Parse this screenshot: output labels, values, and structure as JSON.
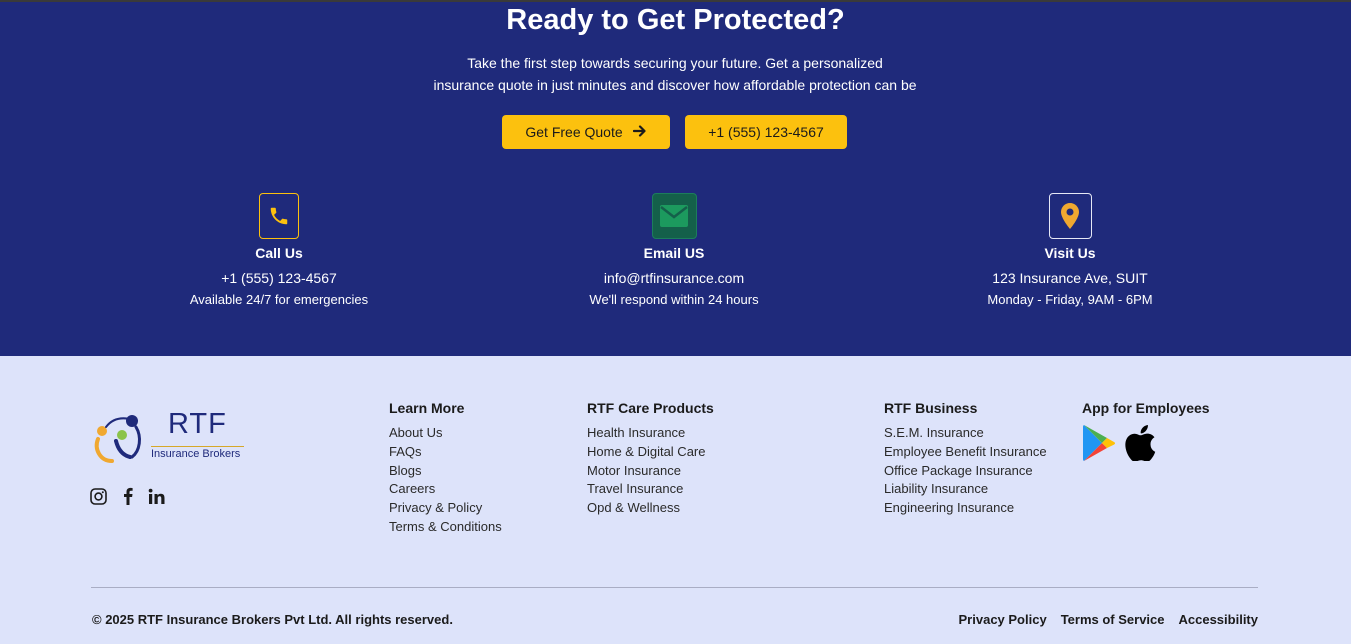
{
  "cta": {
    "title": "Ready to Get Protected?",
    "subtitle_line1": "Take the first step towards securing your future. Get a personalized",
    "subtitle_line2": "insurance quote in just minutes and discover how affordable protection can be",
    "quote_button": "Get Free Quote",
    "phone_button": "+1 (555) 123-4567"
  },
  "contacts": [
    {
      "icon": "phone-icon",
      "title": "Call Us",
      "line1": "+1 (555) 123-4567",
      "line2": "Available 24/7 for emergencies"
    },
    {
      "icon": "envelope-icon",
      "title": "Email US",
      "line1": "info@rtfinsurance.com",
      "line2": "We'll respond within 24 hours"
    },
    {
      "icon": "map-pin-icon",
      "title": "Visit Us",
      "line1": "123 Insurance Ave, SUIT",
      "line2": "Monday - Friday, 9AM - 6PM"
    }
  ],
  "brand": {
    "name": "RTF",
    "tagline": "Insurance Brokers",
    "social": [
      "instagram-icon",
      "facebook-icon",
      "linkedin-icon"
    ]
  },
  "footer": {
    "learn_more": {
      "title": "Learn More",
      "links": [
        "About Us",
        "FAQs",
        "Blogs",
        "Careers",
        "Privacy & Policy",
        "Terms & Conditions"
      ]
    },
    "care_products": {
      "title": "RTF Care Products",
      "links": [
        "Health Insurance",
        "Home & Digital Care",
        "Motor Insurance",
        "Travel Insurance",
        "Opd & Wellness"
      ]
    },
    "business": {
      "title": "RTF Business",
      "links": [
        "S.E.M. Insurance",
        "Employee Benefit Insurance",
        "Office Package Insurance",
        "Liability Insurance",
        "Engineering Insurance"
      ]
    },
    "app": {
      "title": "App for Employees",
      "stores": [
        "google-play-icon",
        "apple-icon"
      ]
    },
    "copyright": "© 2025 RTF Insurance Brokers Pvt Ltd. All rights reserved.",
    "legal": [
      "Privacy Policy",
      "Terms of Service",
      "Accessibility"
    ]
  },
  "colors": {
    "navy": "#1f2a7b",
    "accent": "#fcc10e",
    "footer_bg": "#dde3fa",
    "email_icon_bg": "#14604a"
  }
}
